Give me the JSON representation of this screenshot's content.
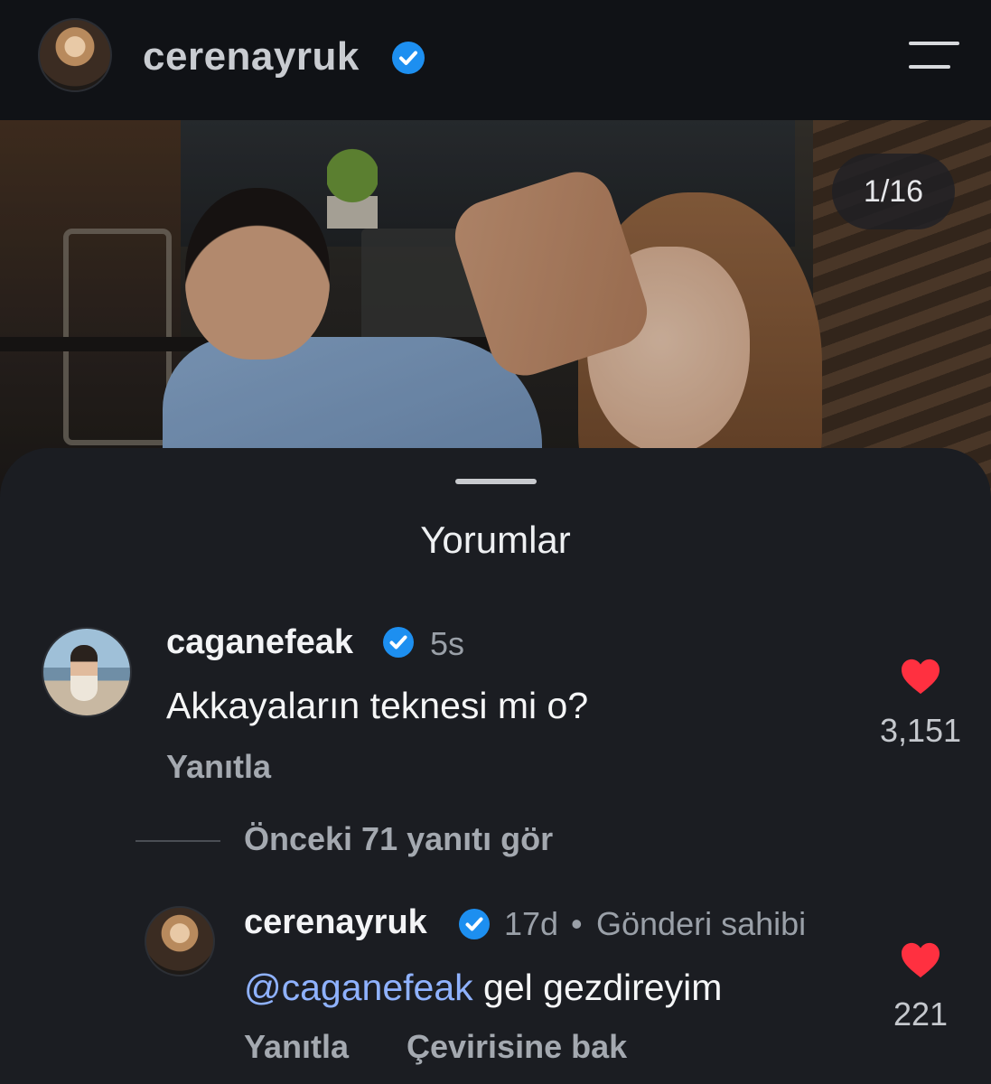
{
  "header": {
    "username": "cerenayruk",
    "verified_icon": "verified-badge-icon",
    "menu_icon": "menu-icon"
  },
  "media": {
    "counter": "1/16"
  },
  "comments_sheet": {
    "title": "Yorumlar",
    "comments": [
      {
        "username": "caganefeak",
        "time": "5s",
        "text": "Akkayaların teknesi mi o?",
        "reply_label": "Yanıtla",
        "likes": "3,151"
      }
    ],
    "view_replies": "Önceki 71 yanıtı gör",
    "reply": {
      "username": "cerenayruk",
      "time": "17d",
      "separator": "•",
      "owner_label": "Gönderi sahibi",
      "mention": "@caganefeak",
      "text": " gel gezdireyim",
      "reply_label": "Yanıtla",
      "translate_label": "Çevirisine bak",
      "likes": "221"
    }
  },
  "colors": {
    "verified": "#1d8ff0",
    "heart": "#ff3040",
    "mention": "#8fb2ff"
  }
}
